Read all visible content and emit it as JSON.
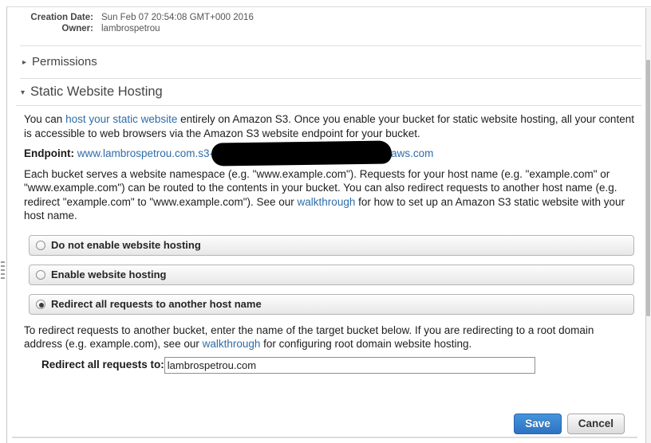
{
  "meta": {
    "creation_date_label": "Creation Date:",
    "creation_date_value": "Sun Feb 07 20:54:08 GMT+000 2016",
    "owner_label": "Owner:",
    "owner_value": "lambrospetrou"
  },
  "sections": {
    "permissions_label": "Permissions",
    "static_hosting_label": "Static Website Hosting"
  },
  "intro_para": {
    "pre": "You can ",
    "link": "host your static website",
    "post": " entirely on Amazon S3. Once you enable your bucket for static website hosting, all your content is accessible to web browsers via the Amazon S3 website endpoint for your bucket."
  },
  "endpoint": {
    "label": "Endpoint:",
    "url_prefix": "www.lambrospetrou.com.s3-",
    "url_suffix": "aws.com",
    "redacted": true
  },
  "namespace_para": {
    "pre": "Each bucket serves a website namespace (e.g. \"www.example.com\"). Requests for your host name (e.g. \"example.com\" or \"www.example.com\") can be routed to the contents in your bucket. You can also redirect requests to another host name (e.g. redirect \"example.com\" to \"www.example.com\"). See our ",
    "link": "walkthrough",
    "post": " for how to set up an Amazon S3 static website with your host name."
  },
  "options": [
    {
      "label": "Do not enable website hosting",
      "selected": false
    },
    {
      "label": "Enable website hosting",
      "selected": false
    },
    {
      "label": "Redirect all requests to another host name",
      "selected": true
    }
  ],
  "redirect_para": {
    "pre": "To redirect requests to another bucket, enter the name of the target bucket below. If you are redirecting to a root domain address (e.g. example.com), see our ",
    "link": "walkthrough",
    "post": " for configuring root domain website hosting."
  },
  "redirect_field": {
    "label": "Redirect all requests to:",
    "value": "lambrospetrou.com"
  },
  "actions": {
    "save_label": "Save",
    "cancel_label": "Cancel"
  },
  "colors": {
    "link": "#2e6ca8",
    "save_button": "#2d73c2",
    "redaction": "#000000"
  }
}
